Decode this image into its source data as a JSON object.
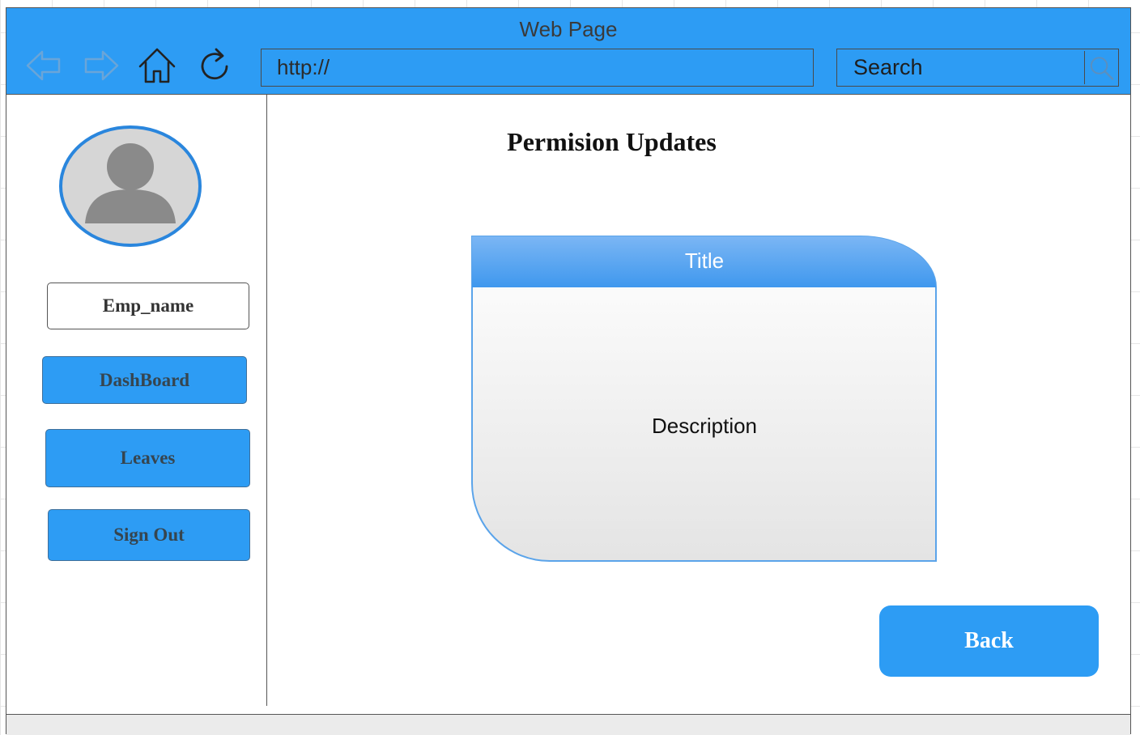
{
  "window": {
    "title": "Web Page",
    "url": "http://",
    "search_label": "Search"
  },
  "icons": {
    "back": "arrow-left-icon",
    "forward": "arrow-right-icon",
    "home": "home-icon",
    "refresh": "refresh-icon",
    "search": "search-icon",
    "avatar": "user-avatar-icon"
  },
  "sidebar": {
    "employee_name": "Emp_name",
    "items": [
      {
        "label": "DashBoard"
      },
      {
        "label": "Leaves"
      },
      {
        "label": "Sign Out"
      }
    ]
  },
  "main": {
    "heading": "Permision Updates",
    "card": {
      "title": "Title",
      "description": "Description"
    },
    "back_label": "Back"
  },
  "colors": {
    "accent": "#2d9cf4",
    "card_header": "#62a9f1",
    "card_body": "#efefef"
  }
}
